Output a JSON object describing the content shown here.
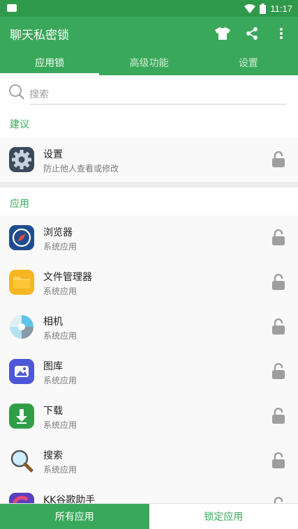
{
  "status_bar": {
    "time": "11:17"
  },
  "app_bar": {
    "title": "聊天私密锁",
    "icons": [
      "tshirt-icon",
      "share-icon",
      "more-vert-icon"
    ]
  },
  "tabs": [
    {
      "label": "应用锁",
      "active": true
    },
    {
      "label": "高级功能",
      "active": false
    },
    {
      "label": "设置",
      "active": false
    }
  ],
  "search": {
    "placeholder": "搜索"
  },
  "sections": {
    "suggest": "建议",
    "apps": "应用"
  },
  "suggest_items": [
    {
      "name": "设置",
      "sub": "防止他人查看或修改",
      "icon": "settings-gear-icon"
    }
  ],
  "app_items": [
    {
      "name": "浏览器",
      "sub": "系统应用",
      "icon": "compass-icon"
    },
    {
      "name": "文件管理器",
      "sub": "系统应用",
      "icon": "folder-icon"
    },
    {
      "name": "相机",
      "sub": "系统应用",
      "icon": "camera-aperture-icon"
    },
    {
      "name": "图库",
      "sub": "系统应用",
      "icon": "gallery-icon"
    },
    {
      "name": "下载",
      "sub": "系统应用",
      "icon": "download-icon"
    },
    {
      "name": "搜索",
      "sub": "系统应用",
      "icon": "magnifier-icon"
    },
    {
      "name": "KK谷歌助手",
      "sub": "",
      "icon": "kk-app-icon"
    }
  ],
  "bottom_bar": {
    "all_apps": "所有应用",
    "locked_apps": "锁定应用"
  },
  "colors": {
    "primary": "#3aa85a",
    "status": "#2f9a4b",
    "lock": "#9e9e9e"
  }
}
